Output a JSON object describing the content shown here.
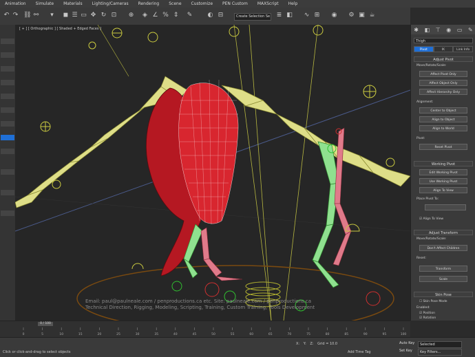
{
  "menu": [
    "Animation",
    "Simulate",
    "Materials",
    "Lighting/Cameras",
    "Rendering",
    "Scene",
    "Customize",
    "PEN Custom",
    "MAXScript",
    "Help"
  ],
  "toolbar": {
    "dropdown_value": "Create Selection Se"
  },
  "viewport": {
    "label": "[ + ] [ Orthographic ] [ Shaded + Edged Faces ]",
    "watermark_line1": "Email: paul@paulneale.com / penproductions.ca etc. Site: paulneale.com / penproductions.ca",
    "watermark_line2": "Technical Direction, Rigging, Modeling, Scripting, Training, Custom Training, Tools Development"
  },
  "command_panel": {
    "name_field": "Thigh",
    "tabs": [
      "Pivot",
      "IK",
      "Link Info"
    ],
    "adjust_pivot": {
      "title": "Adjust Pivot",
      "move_rotate_scale": "Move/Rotate/Scale:",
      "buttons": [
        "Affect Pivot Only",
        "Affect Object Only",
        "Affect Hierarchy Only"
      ]
    },
    "alignment": {
      "title": "Alignment:",
      "buttons": [
        "Center to Object",
        "Align to Object",
        "Align to World"
      ]
    },
    "pivot": {
      "title": "Pivot:",
      "button": "Reset Pivot"
    },
    "working_pivot": {
      "title": "Working Pivot",
      "buttons": [
        "Edit Working Pivot",
        "Use Working Pivot",
        "Align To View",
        "Place Pivot To:"
      ],
      "check": "Align To View"
    },
    "adjust_transform": {
      "title": "Adjust Transform",
      "move_rotate_scale": "Move/Rotate/Scale:",
      "button": "Don't Affect Children"
    },
    "reset": {
      "title": "Reset:",
      "buttons": [
        "Transform",
        "Scale"
      ]
    },
    "skin_pose": {
      "title": "Skin Pose",
      "enabled_label": "Skin Pose Mode",
      "enabled_title": "Enabled:",
      "checks": [
        "Position",
        "Rotation",
        "Scale"
      ]
    }
  },
  "timeline": {
    "frame": "0 / 100",
    "ticks": [
      "0",
      "5",
      "10",
      "15",
      "20",
      "25",
      "30",
      "35",
      "40",
      "45",
      "50",
      "55",
      "60",
      "65",
      "70",
      "75",
      "80",
      "85",
      "90",
      "95",
      "100"
    ]
  },
  "status": {
    "message": "Click or click-and-drag to select objects",
    "coords": [
      {
        "label": "X:",
        "value": ""
      },
      {
        "label": "Y:",
        "value": ""
      },
      {
        "label": "Z:",
        "value": ""
      }
    ],
    "grid": "Grid = 10.0",
    "add_time_tag": "Add Time Tag",
    "auto_key": "Auto Key",
    "selected_value": "Selected",
    "set_key": "Set Key",
    "key_filters": "Key Filters..."
  }
}
